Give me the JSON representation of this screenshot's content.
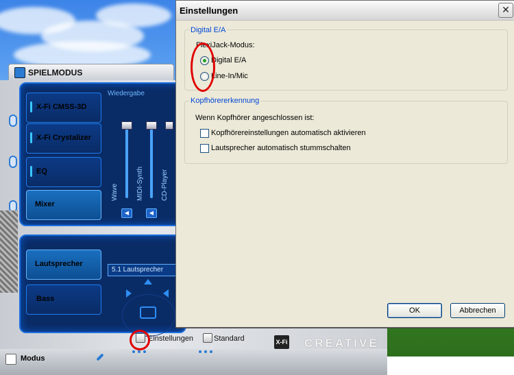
{
  "app": {
    "window_title": "SPIELMODUS",
    "tabs": [
      {
        "label": "X-Fi CMSS-3D"
      },
      {
        "label": "X-Fi Crystalizer"
      },
      {
        "label": "EQ"
      },
      {
        "label": "Mixer"
      }
    ],
    "playback_title": "Wiedergabe",
    "mixer_channels": [
      "Wave",
      "MIDI-Synth",
      "CD-Player"
    ],
    "lower_tabs": [
      {
        "label": "Lautsprecher"
      },
      {
        "label": "Bass"
      }
    ],
    "speaker_mode": "5.1 Lautsprecher",
    "bottom": {
      "modus_label": "Modus",
      "settings_label": "Einstellungen",
      "standard_label": "Standard",
      "xfi_logo": "X-Fi",
      "brand": "CREATIVE"
    }
  },
  "dialog": {
    "title": "Einstellungen",
    "close_glyph": "✕",
    "digital_group": {
      "title": "Digital E/A",
      "flexijack_label": "FlexiJack-Modus:",
      "options": [
        {
          "label": "Digital E/A",
          "selected": true
        },
        {
          "label": "Line-In/Mic",
          "selected": false
        }
      ]
    },
    "headphone_group": {
      "title": "Kopfhörererkennung",
      "intro": "Wenn Kopfhörer angeschlossen ist:",
      "options": [
        {
          "label": "Kopfhörereinstellungen automatisch aktivieren",
          "checked": false
        },
        {
          "label": "Lautsprecher automatisch stummschalten",
          "checked": false
        }
      ]
    },
    "ok_label": "OK",
    "cancel_label": "Abbrechen"
  },
  "colors": {
    "accent_blue": "#1c6fe0",
    "annotation_red": "#e00000",
    "group_title": "#0046d5"
  }
}
